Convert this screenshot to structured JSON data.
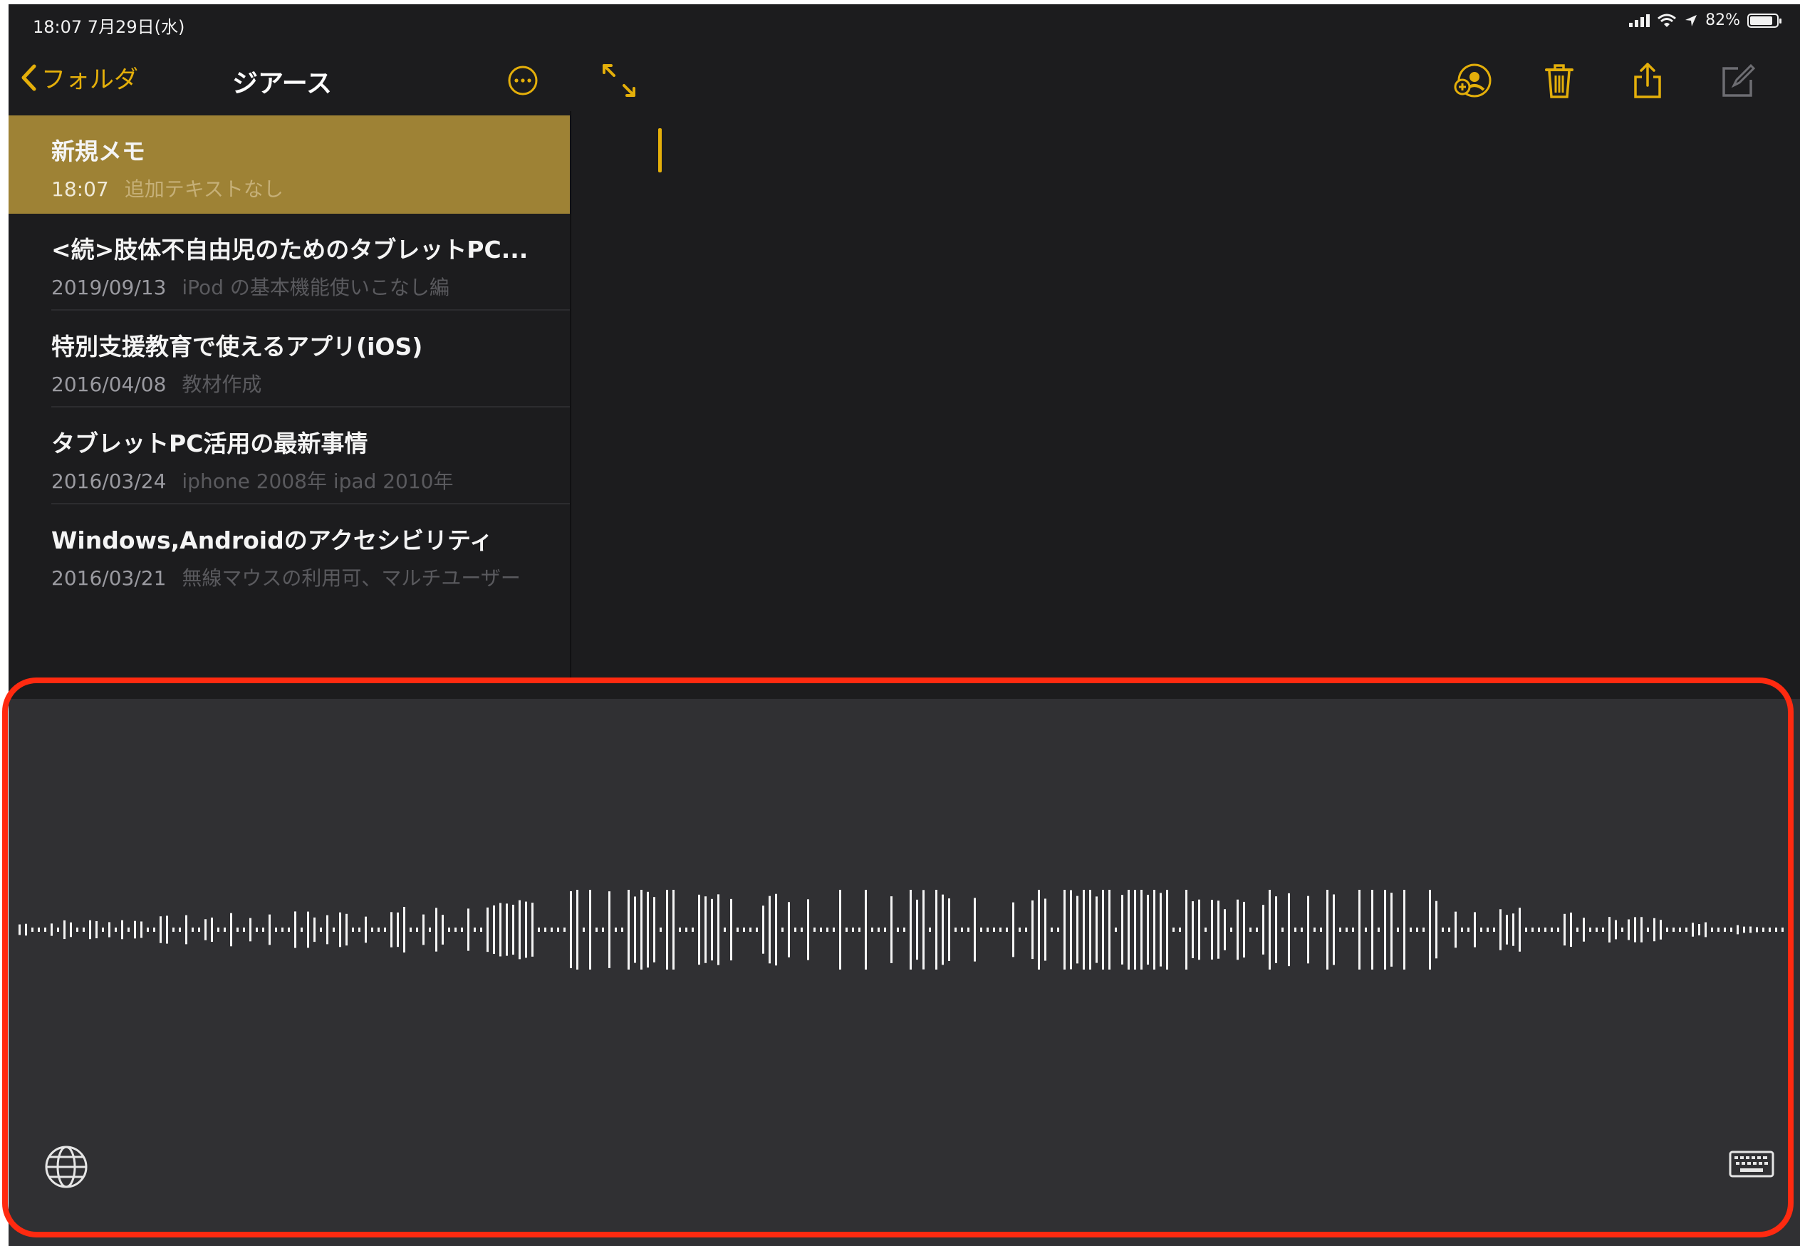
{
  "status_bar": {
    "time": "18:07  7月29日(水)",
    "battery": "82%"
  },
  "sidebar": {
    "back_label": "フォルダ",
    "title": "ジアース",
    "notes": [
      {
        "title": "新規メモ",
        "date": "18:07",
        "preview": "追加テキストなし",
        "selected": true
      },
      {
        "title": "<続>肢体不自由児のためのタブレットPC...",
        "date": "2019/09/13",
        "preview": "iPod の基本機能使いこなし編"
      },
      {
        "title": "特別支援教育で使えるアプリ(iOS)",
        "date": "2016/04/08",
        "preview": "教材作成"
      },
      {
        "title": "タブレットPC活用の最新事情",
        "date": "2016/03/24",
        "preview": "iphone 2008年 ipad 2010年"
      },
      {
        "title": "Windows,Androidのアクセシビリティ",
        "date": "2016/03/21",
        "preview": "無線マウスの利用可、マルチユーザー"
      }
    ]
  },
  "colors": {
    "accent": "#e4af0a",
    "selected_row": "#9e8235",
    "background": "#1c1c1e",
    "dictation_panel": "#303033",
    "highlight_border": "#ff2a10"
  },
  "icons": {
    "back": "chevron-left-icon",
    "more": "ellipsis-circle-icon",
    "expand": "expand-arrows-icon",
    "share_person": "add-person-icon",
    "trash": "trash-icon",
    "share": "share-icon",
    "compose": "compose-icon",
    "globe": "globe-icon",
    "keyboard": "keyboard-icon"
  }
}
